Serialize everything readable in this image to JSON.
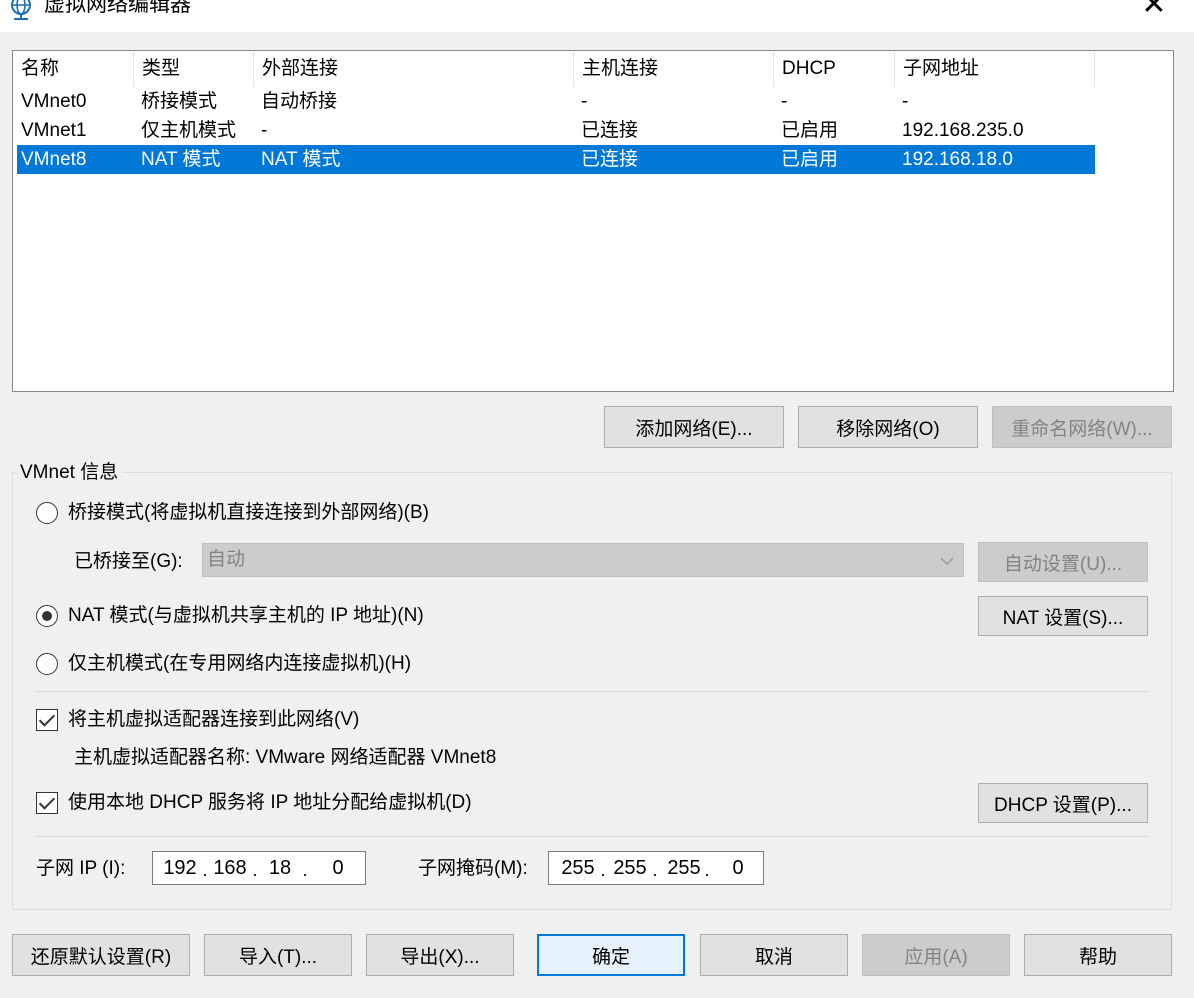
{
  "window": {
    "title": "虚拟网络编辑器",
    "title_icon": "network-globe-icon",
    "close_glyph": "✕"
  },
  "network_list": {
    "columns": [
      "名称",
      "类型",
      "外部连接",
      "主机连接",
      "DHCP",
      "子网地址"
    ],
    "rows": [
      [
        "VMnet0",
        "桥接模式",
        "自动桥接",
        "-",
        "-",
        "-"
      ],
      [
        "VMnet1",
        "仅主机模式",
        "-",
        "已连接",
        "已启用",
        "192.168.235.0"
      ],
      [
        "VMnet8",
        "NAT 模式",
        "NAT 模式",
        "已连接",
        "已启用",
        "192.168.18.0"
      ]
    ],
    "selected_row": 2
  },
  "list_buttons": {
    "add": "添加网络(E)...",
    "remove": "移除网络(O)",
    "rename": "重命名网络(W)..."
  },
  "vmnet_info": {
    "title": "VMnet 信息",
    "bridged_label": "桥接模式(将虚拟机直接连接到外部网络)(B)",
    "bridged_to_label": "已桥接至(G):",
    "bridged_to_value": "自动",
    "auto_settings": "自动设置(U)...",
    "nat_label": "NAT 模式(与虚拟机共享主机的 IP 地址)(N)",
    "nat_settings": "NAT 设置(S)...",
    "hostonly_label": "仅主机模式(在专用网络内连接虚拟机)(H)",
    "selected_mode": "nat",
    "connect_adapter_label": "将主机虚拟适配器连接到此网络(V)",
    "connect_adapter_checked": true,
    "adapter_name_label": "主机虚拟适配器名称: VMware 网络适配器 VMnet8",
    "dhcp_label": "使用本地 DHCP 服务将 IP 地址分配给虚拟机(D)",
    "dhcp_checked": true,
    "dhcp_settings": "DHCP 设置(P)...",
    "subnet_ip_label": "子网 IP (I):",
    "subnet_ip": [
      "192",
      "168",
      "18",
      "0"
    ],
    "subnet_mask_label": "子网掩码(M):",
    "subnet_mask": [
      "255",
      "255",
      "255",
      "0"
    ]
  },
  "footer": {
    "restore": "还原默认设置(R)",
    "import": "导入(T)...",
    "export": "导出(X)...",
    "ok": "确定",
    "cancel": "取消",
    "apply": "应用(A)",
    "help": "帮助"
  }
}
